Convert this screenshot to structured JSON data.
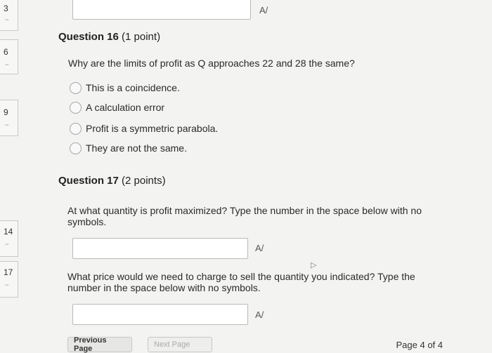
{
  "question_nav": [
    {
      "num": "3",
      "dash": "--"
    },
    {
      "num": "6",
      "dash": "--"
    },
    {
      "num": "9",
      "dash": "--"
    },
    {
      "num": "14",
      "dash": "--"
    },
    {
      "num": "17",
      "dash": "--"
    }
  ],
  "q16": {
    "title": "Question 16",
    "points": "(1 point)",
    "prompt": "Why are the limits of profit as Q approaches 22 and 28 the same?",
    "options": [
      "This is a coincidence.",
      "A calculation error",
      "Profit is a symmetric parabola.",
      "They are not the same."
    ]
  },
  "q17": {
    "title": "Question 17",
    "points": "(2 points)",
    "prompt1": "At what quantity is profit maximized? Type the number in the space below with no symbols.",
    "prompt2": "What price would we need to charge to sell the quantity you indicated? Type the number in the space below with no symbols."
  },
  "spellcheck_glyph": "A/",
  "footer": {
    "previous": "Previous Page",
    "next": "Next Page",
    "page_indicator": "Page 4 of 4"
  }
}
